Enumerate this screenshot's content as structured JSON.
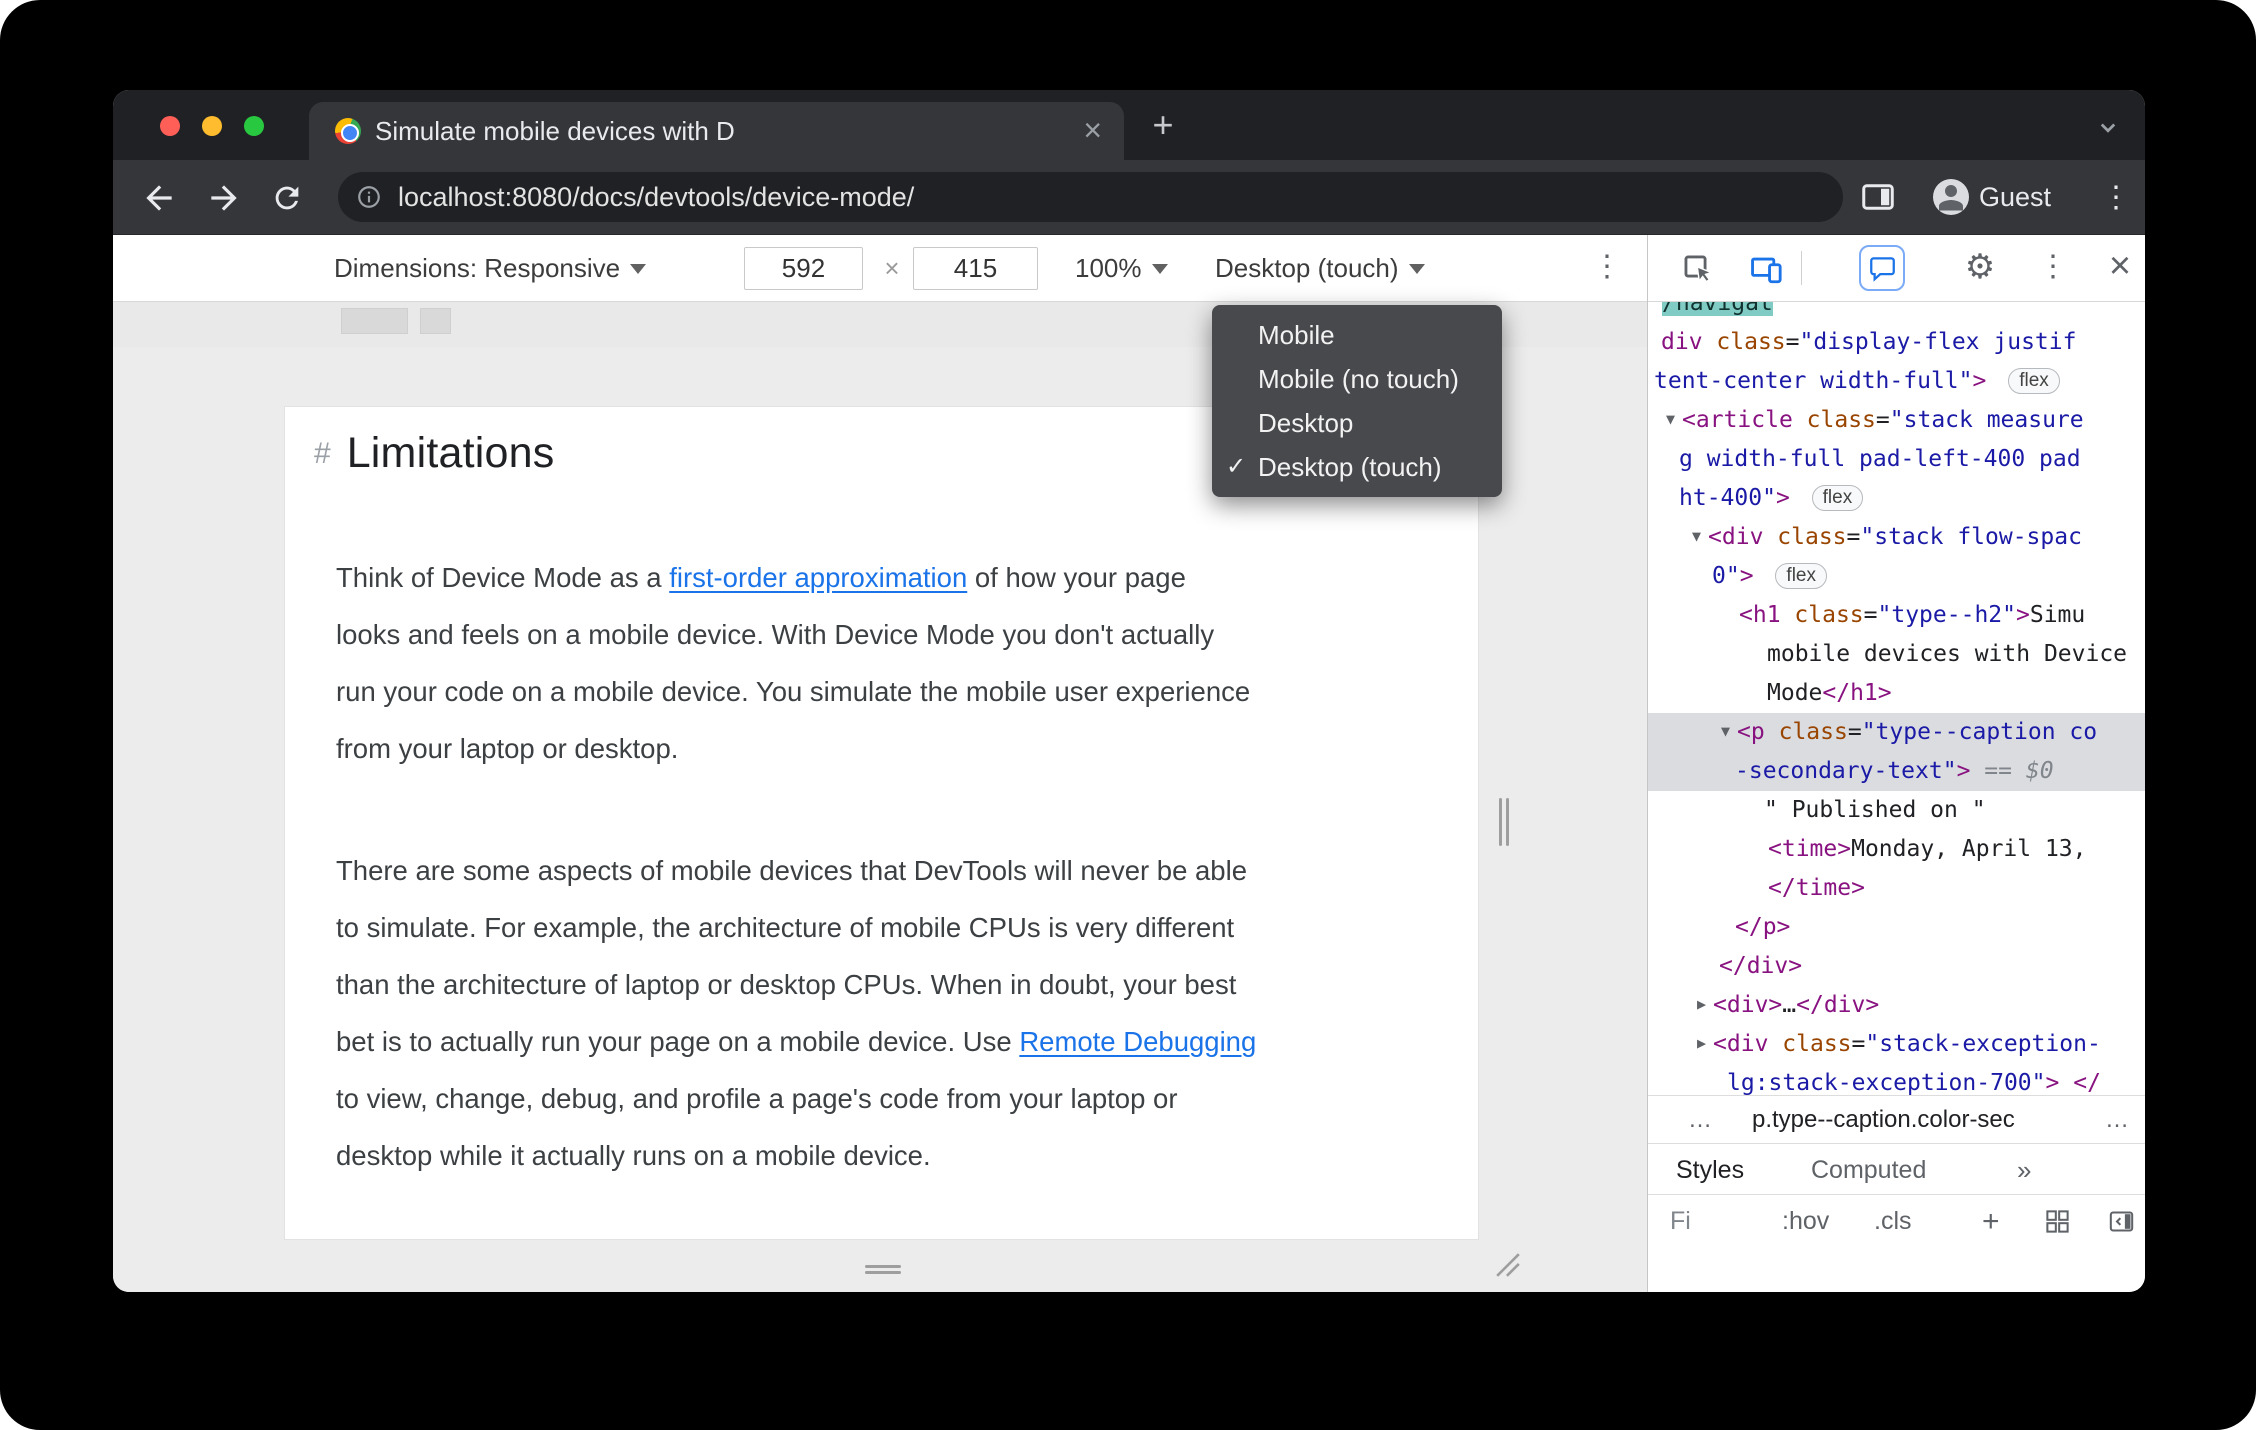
{
  "icons": {
    "close": "×",
    "plus": "+",
    "more_vert": "⋮",
    "gear": "⚙",
    "check": "✓"
  },
  "browser": {
    "tab": {
      "title": "Simulate mobile devices with D"
    },
    "url": "localhost:8080/docs/devtools/device-mode/",
    "profile": "Guest"
  },
  "device_toolbar": {
    "dimensions": "Dimensions: Responsive",
    "width": "592",
    "multiply": "×",
    "height": "415",
    "zoom": "100%",
    "device_type": "Desktop (touch)"
  },
  "device_menu": {
    "check": "✓",
    "items": [
      {
        "label": "Mobile",
        "checked": false
      },
      {
        "label": "Mobile (no touch)",
        "checked": false
      },
      {
        "label": "Desktop",
        "checked": false
      },
      {
        "label": "Desktop (touch)",
        "checked": true
      }
    ]
  },
  "page": {
    "heading_marker": "#",
    "heading": "Limitations",
    "paragraphs": [
      {
        "lines": [
          {
            "segs": [
              {
                "t": "Think of Device Mode as a ",
                "c": "plain-body"
              },
              {
                "t": "first-order approximation",
                "c": "link"
              },
              {
                "t": " of how your page",
                "c": "plain-body"
              }
            ]
          },
          {
            "segs": [
              {
                "t": "looks and feels on a mobile device. With Device Mode you don't actually",
                "c": "plain-body"
              }
            ]
          },
          {
            "segs": [
              {
                "t": "run your code on a mobile device. You simulate the mobile user experience",
                "c": "plain-body"
              }
            ]
          },
          {
            "segs": [
              {
                "t": "from your laptop or desktop.",
                "c": "plain-body"
              }
            ]
          }
        ]
      },
      {
        "lines": [
          {
            "segs": [
              {
                "t": "There are some aspects of mobile devices that DevTools will never be able",
                "c": "plain-body"
              }
            ]
          },
          {
            "segs": [
              {
                "t": "to simulate. For example, the architecture of mobile CPUs is very different",
                "c": "plain-body"
              }
            ]
          },
          {
            "segs": [
              {
                "t": "than the architecture of laptop or desktop CPUs. When in doubt, your best",
                "c": "plain-body"
              }
            ]
          },
          {
            "segs": [
              {
                "t": "bet is to actually run your page on a mobile device. Use ",
                "c": "plain-body"
              },
              {
                "t": "Remote Debugging",
                "c": "link"
              }
            ]
          },
          {
            "segs": [
              {
                "t": "to view, change, debug, and profile a page's code from your laptop or",
                "c": "plain-body"
              }
            ]
          },
          {
            "segs": [
              {
                "t": "desktop while it actually runs on a mobile device.",
                "c": "plain-body"
              }
            ]
          }
        ]
      }
    ]
  },
  "devtools": {
    "tree_lines": [
      {
        "indent": 14,
        "segs": [
          {
            "t": "/navigat",
            "c": "teal"
          }
        ]
      },
      {
        "indent": 13,
        "segs": [
          {
            "t": "div",
            "c": "tag"
          },
          {
            "t": " ",
            "c": "plain"
          },
          {
            "t": "class",
            "c": "attr"
          },
          {
            "t": "=",
            "c": "plain"
          },
          {
            "t": "\"display-flex justif",
            "c": "val"
          }
        ]
      },
      {
        "indent": 6,
        "segs": [
          {
            "t": "tent-center width-full\"",
            "c": "val"
          },
          {
            "t": ">",
            "c": "tag"
          },
          {
            "t": " ",
            "c": "plain"
          },
          {
            "t": "flex",
            "c": "badge"
          }
        ]
      },
      {
        "indent": 18,
        "segs": [
          {
            "t": "▼",
            "c": "exp"
          },
          {
            "t": "<article",
            "c": "tag"
          },
          {
            "t": " ",
            "c": "plain"
          },
          {
            "t": "class",
            "c": "attr"
          },
          {
            "t": "=",
            "c": "plain"
          },
          {
            "t": "\"stack measure",
            "c": "val"
          }
        ]
      },
      {
        "indent": 31,
        "segs": [
          {
            "t": "g width-full pad-left-400 pad",
            "c": "val"
          }
        ]
      },
      {
        "indent": 31,
        "segs": [
          {
            "t": "ht-400\"",
            "c": "val"
          },
          {
            "t": ">",
            "c": "tag"
          },
          {
            "t": " ",
            "c": "plain"
          },
          {
            "t": "flex",
            "c": "badge"
          }
        ]
      },
      {
        "indent": 44,
        "segs": [
          {
            "t": "▼",
            "c": "exp"
          },
          {
            "t": "<div",
            "c": "tag"
          },
          {
            "t": " ",
            "c": "plain"
          },
          {
            "t": "class",
            "c": "attr"
          },
          {
            "t": "=",
            "c": "plain"
          },
          {
            "t": "\"stack flow-spac",
            "c": "val"
          }
        ]
      },
      {
        "indent": 64,
        "segs": [
          {
            "t": "0\"",
            "c": "val"
          },
          {
            "t": ">",
            "c": "tag"
          },
          {
            "t": " ",
            "c": "plain"
          },
          {
            "t": "flex",
            "c": "badge"
          }
        ]
      },
      {
        "indent": 91,
        "segs": [
          {
            "t": "<h1",
            "c": "tag"
          },
          {
            "t": " ",
            "c": "plain"
          },
          {
            "t": "class",
            "c": "attr"
          },
          {
            "t": "=",
            "c": "plain"
          },
          {
            "t": "\"type--h2\"",
            "c": "val"
          },
          {
            "t": ">",
            "c": "tag"
          },
          {
            "t": "Simu",
            "c": "plain"
          }
        ]
      },
      {
        "indent": 119,
        "segs": [
          {
            "t": "mobile devices with Device",
            "c": "plain"
          }
        ]
      },
      {
        "indent": 119,
        "segs": [
          {
            "t": "Mode",
            "c": "plain"
          },
          {
            "t": "</h1>",
            "c": "tag"
          }
        ]
      },
      {
        "indent": 73,
        "selected": true,
        "segs": [
          {
            "t": "▼",
            "c": "exp"
          },
          {
            "t": "<p",
            "c": "tag"
          },
          {
            "t": " ",
            "c": "plain"
          },
          {
            "t": "class",
            "c": "attr"
          },
          {
            "t": "=",
            "c": "plain"
          },
          {
            "t": "\"type--caption co",
            "c": "val"
          }
        ]
      },
      {
        "indent": 87,
        "selected": true,
        "segs": [
          {
            "t": "-secondary-text\"",
            "c": "val"
          },
          {
            "t": ">",
            "c": "tag"
          },
          {
            "t": " ",
            "c": "plain"
          },
          {
            "t": "==",
            "c": "eq"
          },
          {
            "t": " ",
            "c": "plain"
          },
          {
            "t": "$0",
            "c": "dollar"
          }
        ]
      },
      {
        "indent": 116,
        "segs": [
          {
            "t": "\" Published on \"",
            "c": "plain"
          }
        ]
      },
      {
        "indent": 120,
        "segs": [
          {
            "t": "<time>",
            "c": "tag"
          },
          {
            "t": "Monday, April 13,",
            "c": "plain"
          }
        ]
      },
      {
        "indent": 120,
        "segs": [
          {
            "t": "</time>",
            "c": "tag"
          }
        ]
      },
      {
        "indent": 87,
        "segs": [
          {
            "t": "</p>",
            "c": "tag"
          }
        ]
      },
      {
        "indent": 71,
        "segs": [
          {
            "t": "</div>",
            "c": "tag"
          }
        ]
      },
      {
        "indent": 49,
        "segs": [
          {
            "t": "▶",
            "c": "exp"
          },
          {
            "t": "<div>",
            "c": "tag"
          },
          {
            "t": "…",
            "c": "plain"
          },
          {
            "t": "</div>",
            "c": "tag"
          }
        ]
      },
      {
        "indent": 49,
        "segs": [
          {
            "t": "▶",
            "c": "exp"
          },
          {
            "t": "<div",
            "c": "tag"
          },
          {
            "t": " ",
            "c": "plain"
          },
          {
            "t": "class",
            "c": "attr"
          },
          {
            "t": "=",
            "c": "plain"
          },
          {
            "t": "\"stack-exception-",
            "c": "val"
          }
        ]
      },
      {
        "indent": 79,
        "segs": [
          {
            "t": "lg:stack-exception-700\"",
            "c": "val"
          },
          {
            "t": ">",
            "c": "tag"
          },
          {
            "t": " ",
            "c": "plain"
          },
          {
            "t": "</",
            "c": "tag"
          }
        ]
      }
    ],
    "breadcrumb": {
      "more_left": "…",
      "selected": "p.type--caption.color-sec",
      "more_right": "…"
    },
    "tabs": {
      "styles": "Styles",
      "computed": "Computed",
      "overflow": "»"
    },
    "styles_bar": {
      "filter": "Fi",
      "hov": ":hov",
      "cls": ".cls",
      "add": "+"
    }
  }
}
